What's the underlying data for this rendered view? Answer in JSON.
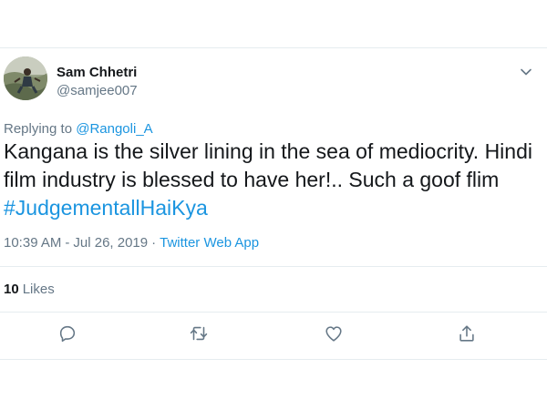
{
  "user": {
    "display_name": "Sam Chhetri",
    "handle": "@samjee007",
    "avatar_icon": "profile-photo"
  },
  "reply": {
    "prefix": "Replying to",
    "mention": "@Rangoli_A"
  },
  "tweet": {
    "text": "Kangana is the silver lining in the sea of mediocrity. Hindi film industry is blessed to have her!.. Such a goof flim",
    "hashtag": "#JudgementallHaiKya"
  },
  "meta": {
    "time": "10:39 AM",
    "separator1": "-",
    "date": "Jul 26, 2019",
    "separator2": "·",
    "source": "Twitter Web App"
  },
  "stats": {
    "likes_count": "10",
    "likes_label": "Likes"
  },
  "actions": {
    "reply_icon": "reply-icon",
    "retweet_icon": "retweet-icon",
    "like_icon": "heart-icon",
    "share_icon": "share-icon"
  },
  "colors": {
    "link": "#1b95e0",
    "muted": "#657786",
    "text": "#14171a",
    "divider": "#e6ecf0"
  }
}
